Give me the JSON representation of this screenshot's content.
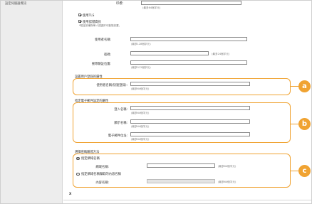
{
  "left": {
    "section_label": "設定伺服器資訊"
  },
  "top": {
    "port_label": "印標:",
    "port_hint": "(最多64個字元)",
    "tls_label": "使用TLS",
    "use_auth_label": "使用認證資訊",
    "auth_note": "*驗証設備與單人認證許可動態設置。",
    "username_label": "使用者名稱:",
    "username_hint": "(最多128個字元)",
    "password_label": "密碼:",
    "password_hint": "(最多24個字元)",
    "auth_info_label": "搜尋驗証位置:",
    "auth_info_hint": "(最多512個字元)"
  },
  "section_a": {
    "title": "設置用戶登錄的屬性",
    "field_label": "使用者名稱(快速登錄):",
    "field_hint": "(最多64個字元)",
    "callout": "a"
  },
  "section_b": {
    "title": "指定電子郵件設定的屬性",
    "field1_label": "登入名稱:",
    "field1_hint": "(最多64個字元)",
    "field2_label": "顯示名稱:",
    "field2_hint": "(最多64個字元)",
    "field3_label": "電子郵件位址:",
    "field3_hint": "(最多64個字元)",
    "callout": "b"
  },
  "section_c": {
    "title": "選擇密碼驗證方法",
    "option1_label": "指定網域名稱",
    "domain_label": "網域名稱:",
    "domain_hint": "(最多64個字元)",
    "option2_label": "指定網域名稱擷取的內容名稱",
    "attr_label": "內容名稱:",
    "attr_hint": "(最多64個字元)",
    "callout": "c"
  },
  "footer": {
    "marker": "X"
  },
  "colors": {
    "accent": "#f0a332",
    "sidebar": "#ededed",
    "input_border": "#8a8a8a"
  }
}
